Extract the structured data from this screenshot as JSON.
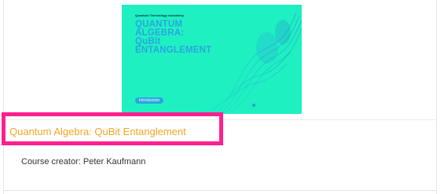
{
  "course": {
    "thumbnail": {
      "brand": "Quantum Technology eAcademy",
      "title_lines": [
        "QUANTUM",
        "ALGEBRA:",
        "QuBit",
        "ENTANGLEMENT"
      ],
      "pill": "Introduction",
      "background_color": "#1ef0c2",
      "title_color": "#2aa5e0"
    },
    "title": "Quantum Algebra: QuBit Entanglement",
    "title_color": "#f5a623",
    "creator": "Course creator: Peter Kaufmann",
    "highlight_color": "#ff1f8f"
  }
}
